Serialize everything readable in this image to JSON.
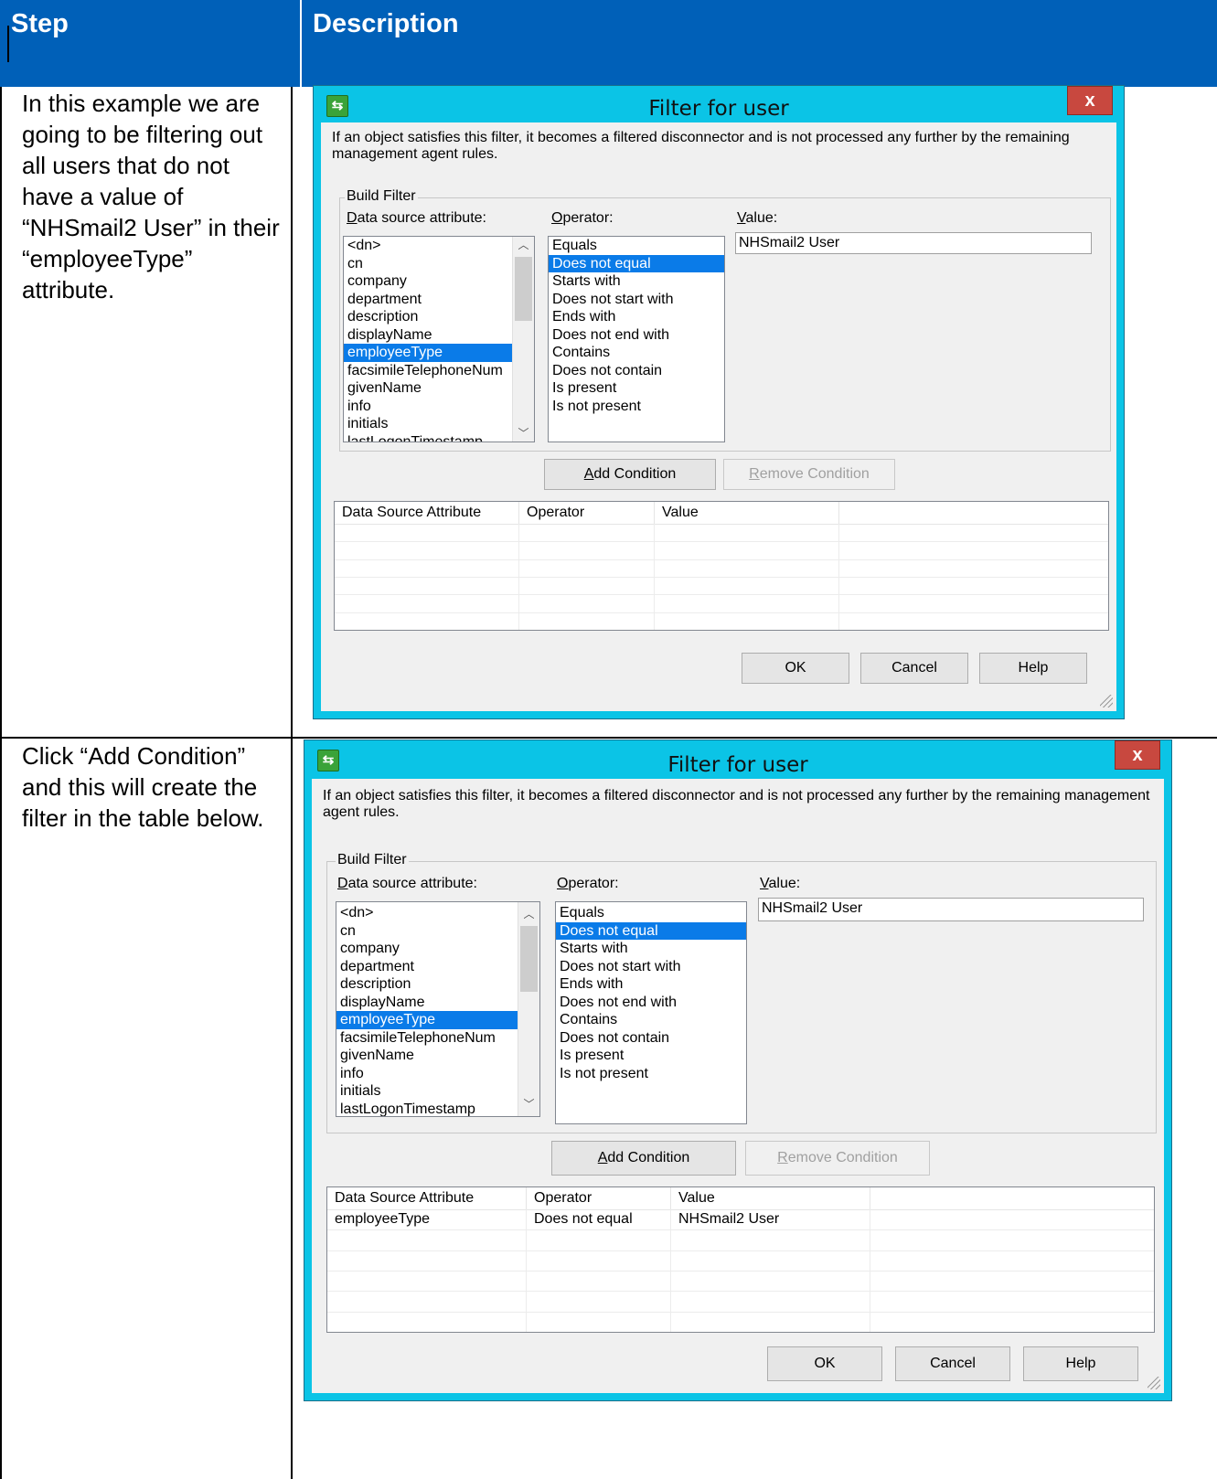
{
  "table": {
    "header_step": "Step",
    "header_description": "Description"
  },
  "rows": [
    {
      "step_text": "In this example  we are going to be filtering out all users that do not have a value of “NHSmail2 User” in their “employeeType” attribute.",
      "dialog": {
        "title": "Filter for user",
        "close_label": "x",
        "message": "If an object satisfies this filter, it becomes a filtered disconnector and is not processed any further by the remaining management agent rules.",
        "group_label": "Build Filter",
        "attr_label_key": "D",
        "attr_label_rest": "ata source attribute:",
        "op_label_key": "O",
        "op_label_rest": "perator:",
        "value_label_key": "V",
        "value_label_rest": "alue:",
        "attributes": [
          "<dn>",
          "cn",
          "company",
          "department",
          "description",
          "displayName",
          "employeeType",
          "facsimileTelephoneNum",
          "givenName",
          "info",
          "initials",
          "lastLogonTimestamp"
        ],
        "selected_attribute": "employeeType",
        "operators": [
          "Equals",
          "Does not equal",
          "Starts with",
          "Does not start with",
          "Ends with",
          "Does not end with",
          "Contains",
          "Does not contain",
          "Is present",
          "Is not present"
        ],
        "selected_operator": "Does not equal",
        "value": "NHSmail2 User",
        "add_key": "A",
        "add_rest": "dd Condition",
        "remove_key": "R",
        "remove_rest": "emove Condition",
        "grid_headers": [
          "Data Source Attribute",
          "Operator",
          "Value"
        ],
        "conditions": [],
        "ok": "OK",
        "cancel": "Cancel",
        "help": "Help"
      }
    },
    {
      "step_text": "Click “Add Condition” and this will create the filter in the table below.",
      "dialog": {
        "title": "Filter for user",
        "close_label": "x",
        "message": "If an object satisfies this filter, it becomes a filtered disconnector and is not processed any further by the remaining management agent rules.",
        "group_label": "Build Filter",
        "attr_label_key": "D",
        "attr_label_rest": "ata source attribute:",
        "op_label_key": "O",
        "op_label_rest": "perator:",
        "value_label_key": "V",
        "value_label_rest": "alue:",
        "attributes": [
          "<dn>",
          "cn",
          "company",
          "department",
          "description",
          "displayName",
          "employeeType",
          "facsimileTelephoneNum",
          "givenName",
          "info",
          "initials",
          "lastLogonTimestamp"
        ],
        "selected_attribute": "employeeType",
        "operators": [
          "Equals",
          "Does not equal",
          "Starts with",
          "Does not start with",
          "Ends with",
          "Does not end with",
          "Contains",
          "Does not contain",
          "Is present",
          "Is not present"
        ],
        "selected_operator": "Does not equal",
        "value": "NHSmail2 User",
        "add_key": "A",
        "add_rest": "dd Condition",
        "remove_key": "R",
        "remove_rest": "emove Condition",
        "grid_headers": [
          "Data Source Attribute",
          "Operator",
          "Value"
        ],
        "conditions": [
          {
            "attribute": "employeeType",
            "operator": "Does not equal",
            "value": "NHSmail2 User"
          }
        ],
        "ok": "OK",
        "cancel": "Cancel",
        "help": "Help"
      }
    }
  ]
}
